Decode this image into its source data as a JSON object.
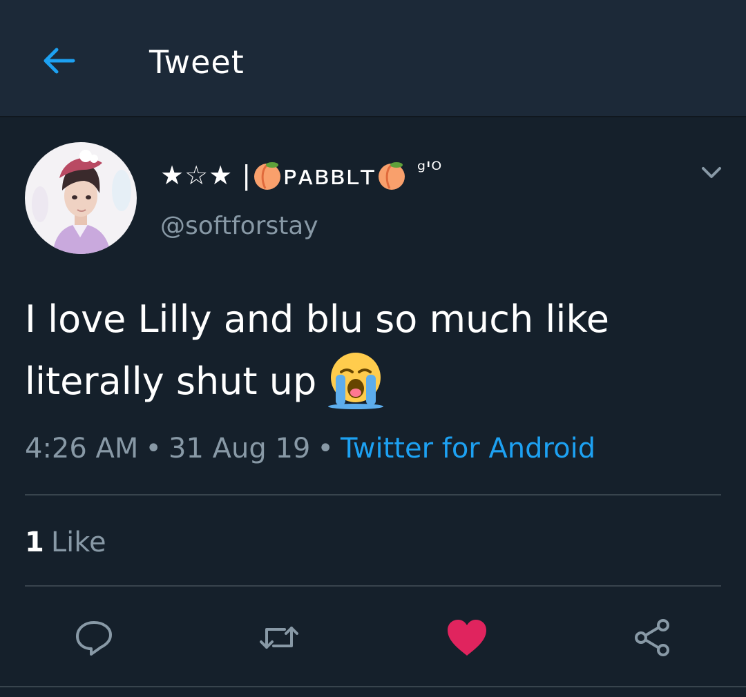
{
  "header": {
    "title": "Tweet"
  },
  "author": {
    "display_name_prefix": "★☆★ |",
    "display_name_middle": "ᴘᴀʙʙʟᴛ",
    "display_name_suffix": "ᵍ'ᴼ",
    "handle": "@softforstay"
  },
  "tweet": {
    "text": "I love Lilly and blu so much like literally shut up",
    "time": "4:26 AM",
    "date": "31 Aug 19",
    "source": "Twitter for Android"
  },
  "stats": {
    "like_count": "1",
    "like_label": "Like"
  },
  "colors": {
    "background": "#15202b",
    "header_bg": "#1c2938",
    "accent": "#1da1f2",
    "muted": "#8899a6",
    "like_red": "#e0245e"
  },
  "icons": {
    "back": "arrow-left-icon",
    "caret": "chevron-down-icon",
    "reply": "reply-icon",
    "retweet": "retweet-icon",
    "like": "heart-icon",
    "share": "share-icon"
  }
}
